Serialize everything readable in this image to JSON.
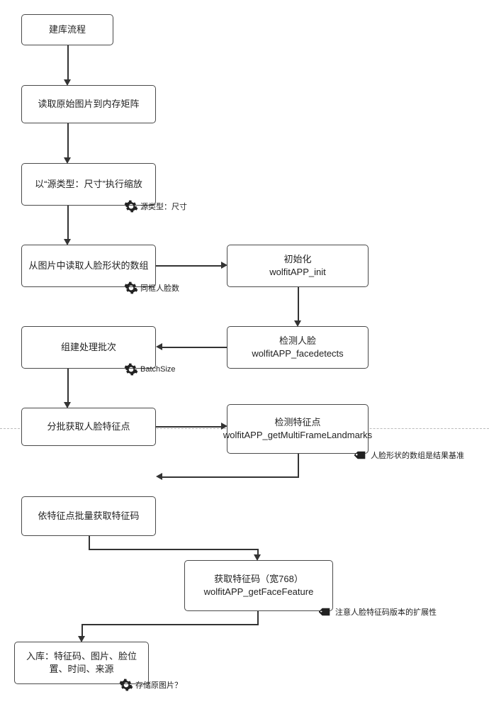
{
  "nodes": {
    "n1": "建库流程",
    "n2": "读取原始图片到内存矩阵",
    "n3": "以“源类型：尺寸”执行缩放",
    "n4": "从图片中读取人脸形状的数组",
    "n5": "初始化\nwolfitAPP_init",
    "n6": "检测人脸\nwolfitAPP_facedetects",
    "n7": "组建处理批次",
    "n8": "分批获取人脸特征点",
    "n9": "检测特征点\nwolfitAPP_getMultiFrameLandmarks",
    "n10": "依特征点批量获取特征码",
    "n11": "获取特征码（宽768）\nwolfitAPP_getFaceFeature",
    "n12": "入库：特征码、图片、脸位置、时间、来源"
  },
  "annots": {
    "a1": "源类型：尺寸",
    "a2": "同框人脸数",
    "a3": "BatchSize",
    "a4": "人脸形状的数组是结果基准",
    "a5": "注意人脸特征码版本的扩展性",
    "a6": "存储原图片？"
  }
}
